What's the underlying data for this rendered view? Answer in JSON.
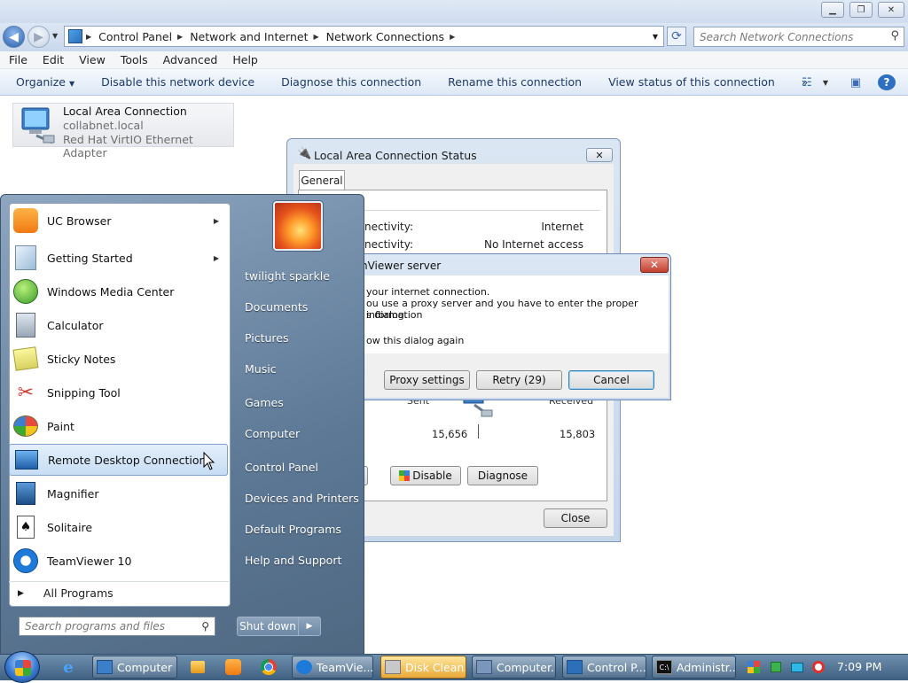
{
  "explorer": {
    "breadcrumb": [
      "Control Panel",
      "Network and Internet",
      "Network Connections"
    ],
    "search_placeholder": "Search Network Connections",
    "menu": [
      "File",
      "Edit",
      "View",
      "Tools",
      "Advanced",
      "Help"
    ],
    "commands": {
      "organize": "Organize",
      "disable": "Disable this network device",
      "diagnose": "Diagnose this connection",
      "rename": "Rename this connection",
      "view_status": "View status of this connection",
      "more": "»"
    },
    "connection": {
      "name": "Local Area Connection",
      "network": "collabnet.local",
      "adapter": "Red Hat VirtIO Ethernet Adapter"
    }
  },
  "status_dialog": {
    "title": "Local Area Connection Status",
    "tab": "General",
    "close_x": "✕",
    "ipv4_label": "nectivity:",
    "ipv4_value": "Internet",
    "ipv6_label": "nectivity:",
    "ipv6_value": "No Internet access",
    "sent_label": "Sent",
    "received_label": "Received",
    "sent_value": "15,656",
    "received_value": "15,803",
    "buttons": {
      "properties": "ies",
      "disable": "Disable",
      "diagnose": "Diagnose",
      "close": "Close"
    }
  },
  "teamviewer_dialog": {
    "title": "nViewer server",
    "line1": "your internet connection.",
    "line2": "ou use a proxy server and you have to enter the proper information",
    "line3": "s dialog.",
    "line4": "ow this dialog again",
    "close_x": "✕",
    "buttons": {
      "proxy": "Proxy settings",
      "retry": "Retry (29)",
      "cancel": "Cancel"
    }
  },
  "start_menu": {
    "programs": [
      {
        "label": "UC Browser",
        "submenu": true
      },
      {
        "label": "Getting Started",
        "submenu": true
      },
      {
        "label": "Windows Media Center",
        "submenu": false
      },
      {
        "label": "Calculator",
        "submenu": false
      },
      {
        "label": "Sticky Notes",
        "submenu": false
      },
      {
        "label": "Snipping Tool",
        "submenu": false
      },
      {
        "label": "Paint",
        "submenu": false
      },
      {
        "label": "Remote Desktop Connection",
        "submenu": false
      },
      {
        "label": "Magnifier",
        "submenu": false
      },
      {
        "label": "Solitaire",
        "submenu": false
      },
      {
        "label": "TeamViewer 10",
        "submenu": false
      }
    ],
    "all_programs": "All Programs",
    "search_placeholder": "Search programs and files",
    "right": [
      "twilight sparkle",
      "Documents",
      "Pictures",
      "Music",
      "Games",
      "Computer",
      "Control Panel",
      "Devices and Printers",
      "Default Programs",
      "Help and Support"
    ],
    "shutdown": "Shut down"
  },
  "taskbar": {
    "buttons": [
      {
        "label": "Computer",
        "active": false
      },
      {
        "label": "TeamVie...",
        "active": false
      },
      {
        "label": "Disk Clean...",
        "active": true
      },
      {
        "label": "Computer...",
        "active": false
      },
      {
        "label": "Control P...",
        "active": false
      },
      {
        "label": "Administr...",
        "active": false
      }
    ],
    "clock": "7:09 PM"
  }
}
